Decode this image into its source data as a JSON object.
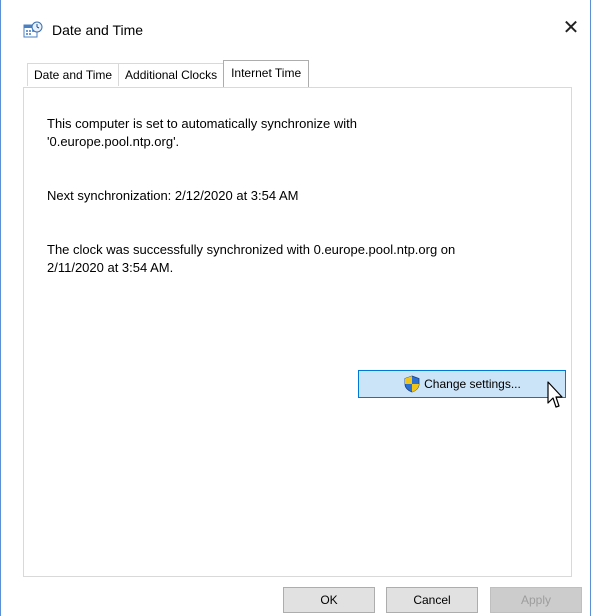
{
  "window": {
    "title": "Date and Time",
    "close_symbol": "✕",
    "icon": "date-time-icon"
  },
  "tabs": [
    {
      "label": "Date and Time",
      "active": false
    },
    {
      "label": "Additional Clocks",
      "active": false
    },
    {
      "label": "Internet Time",
      "active": true
    }
  ],
  "internet_time": {
    "sync_status_line1": "This computer is set to automatically synchronize with",
    "sync_status_line2": "'0.europe.pool.ntp.org'.",
    "next_sync": "Next synchronization: 2/12/2020 at 3:54 AM",
    "result_line1": "The clock was successfully synchronized with 0.europe.pool.ntp.org on",
    "result_line2": "2/11/2020 at 3:54 AM.",
    "change_settings_label": "Change settings..."
  },
  "buttons": {
    "ok": "OK",
    "cancel": "Cancel",
    "apply": "Apply"
  },
  "colors": {
    "window_border": "#5b8fd6",
    "accent": "#0078d7",
    "button_hover_bg": "#cce4f7",
    "disabled_text": "#9d9d9d"
  }
}
